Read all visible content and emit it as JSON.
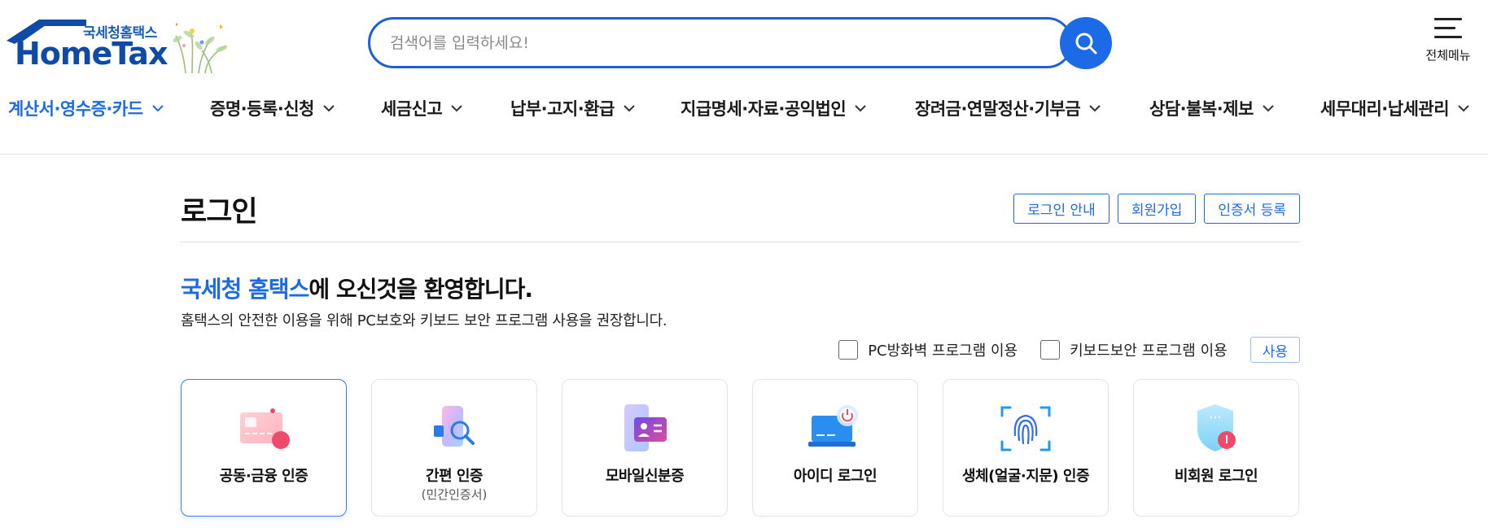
{
  "logo": {
    "sub_text": "국세청홈택스",
    "main_text": "HomeTax"
  },
  "search": {
    "placeholder": "검색어를 입력하세요!"
  },
  "all_menu": {
    "label": "전체메뉴"
  },
  "gnb": [
    {
      "label": "계산서·영수증·카드",
      "active": true
    },
    {
      "label": "증명·등록·신청",
      "active": false
    },
    {
      "label": "세금신고",
      "active": false
    },
    {
      "label": "납부·고지·환급",
      "active": false
    },
    {
      "label": "지급명세·자료·공익법인",
      "active": false
    },
    {
      "label": "장려금·연말정산·기부금",
      "active": false
    },
    {
      "label": "상담·불복·제보",
      "active": false
    },
    {
      "label": "세무대리·납세관리",
      "active": false
    }
  ],
  "page": {
    "title": "로그인",
    "buttons": [
      "로그인 안내",
      "회원가입",
      "인증서 등록"
    ]
  },
  "welcome": {
    "highlight": "국세청 홈택스",
    "rest": "에 오신것을 환영합니다.",
    "notice": "홈택스의 안전한 이용을 위해 PC보호와 키보드 보안 프로그램 사용을 권장합니다."
  },
  "options": {
    "firewall": {
      "label": "PC방화벽 프로그램 이용",
      "checked": false
    },
    "keyboard": {
      "label": "키보드보안 프로그램 이용",
      "checked": false
    },
    "use_label": "사용"
  },
  "login_methods": [
    {
      "label": "공동·금융 인증",
      "sub": "",
      "icon": "certificate-card-icon",
      "selected": true
    },
    {
      "label": "간편 인증",
      "sub": "(민간인증서)",
      "icon": "simple-auth-icon",
      "selected": false
    },
    {
      "label": "모바일신분증",
      "sub": "",
      "icon": "mobile-id-icon",
      "selected": false
    },
    {
      "label": "아이디 로그인",
      "sub": "",
      "icon": "laptop-login-icon",
      "selected": false
    },
    {
      "label": "생체(얼굴·지문) 인증",
      "sub": "",
      "icon": "fingerprint-icon",
      "selected": false
    },
    {
      "label": "비회원 로그인",
      "sub": "",
      "icon": "shield-icon",
      "selected": false
    }
  ],
  "colors": {
    "accent": "#1d6ae6",
    "logo_blue": "#0f4aa6"
  }
}
